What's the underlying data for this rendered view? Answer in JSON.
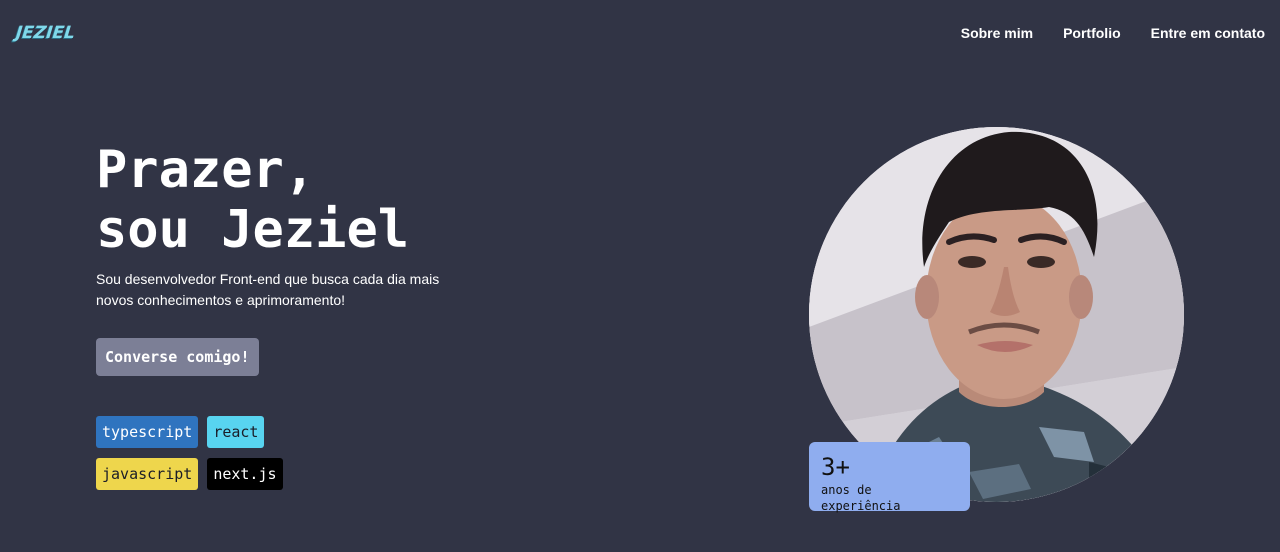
{
  "header": {
    "logo": "JEZIEL",
    "nav": [
      "Sobre mim",
      "Portfolio",
      "Entre em contato"
    ]
  },
  "hero": {
    "greeting": "Prazer,",
    "intro_prefix": "sou ",
    "name": "Jeziel",
    "subtitle": "Sou desenvolvedor Front-end que busca cada dia mais novos conhecimentos e aprimoramento!",
    "cta": "Converse comigo!"
  },
  "tags": [
    {
      "label": "typescript",
      "color": "#2f74bf"
    },
    {
      "label": "react",
      "color": "#58d4f0"
    },
    {
      "label": "javascript",
      "color": "#eed64c"
    },
    {
      "label": "next.js",
      "color": "#000000"
    }
  ],
  "experience": {
    "value": "3+",
    "label": "anos de experiência"
  },
  "colors": {
    "background": "#313445",
    "logo": "#7fd8ea",
    "cta_background": "#7c7f96",
    "badge_background": "#8fadef"
  }
}
